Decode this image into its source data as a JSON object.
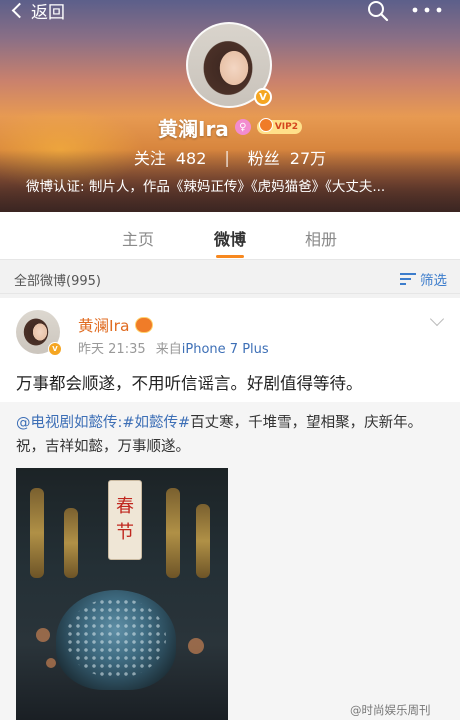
{
  "nav": {
    "back_label": "返回",
    "search_icon": "search-icon",
    "more_icon": "more-icon"
  },
  "profile": {
    "name": "黄澜Ira",
    "vip_label": "VIP2",
    "verified_mark": "V",
    "following_label": "关注",
    "following_count": "482",
    "followers_label": "粉丝",
    "followers_count": "27万",
    "verification": "微博认证: 制片人，作品《辣妈正传》《虎妈猫爸》《大丈夫..."
  },
  "tabs": [
    {
      "label": "主页",
      "active": false
    },
    {
      "label": "微博",
      "active": true
    },
    {
      "label": "相册",
      "active": false
    }
  ],
  "filter": {
    "count_label": "全部微博(995)",
    "filter_label": "筛选"
  },
  "post": {
    "author": "黄澜Ira",
    "verified_mark": "V",
    "time_prefix": "昨天",
    "time": "21:35",
    "source_prefix": "来自",
    "source": "iPhone 7 Plus",
    "text": "万事都会顺遂，不用听信谣言。好剧值得等待。",
    "repost": {
      "link": "@电视剧如懿传:#如懿传#",
      "text": "百丈寒，千堆雪，望相聚，庆新年。祝，吉祥如懿，万事顺遂。",
      "image_banner": [
        "春",
        "节"
      ]
    }
  },
  "watermark": "@时尚娱乐周刊",
  "colors": {
    "accent_orange": "#f7881f",
    "link_blue": "#3d6fb6",
    "author_orange": "#e06b20"
  }
}
